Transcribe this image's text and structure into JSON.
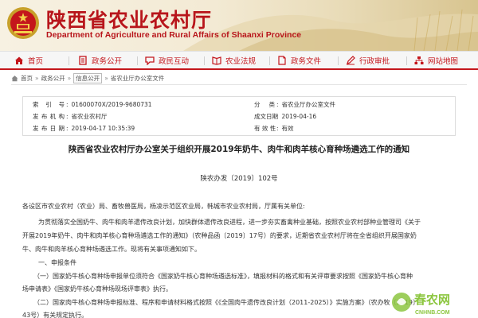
{
  "header": {
    "title": "陕西省农业农村厅",
    "subtitle": "Department of Agriculture and Rural Affairs of Shaanxi Province",
    "emblem_icon": "national-emblem",
    "brand_color": "#b8151b"
  },
  "nav": {
    "items": [
      {
        "label": "首页",
        "icon": "home-icon"
      },
      {
        "label": "政务公开",
        "icon": "document-icon"
      },
      {
        "label": "政民互动",
        "icon": "chat-icon"
      },
      {
        "label": "农业法规",
        "icon": "book-icon"
      },
      {
        "label": "政务文件",
        "icon": "file-icon"
      },
      {
        "label": "行政审批",
        "icon": "pen-icon"
      },
      {
        "label": "网站地图",
        "icon": "sitemap-icon"
      }
    ]
  },
  "breadcrumb": {
    "items": [
      "首页",
      "政务公开",
      "信息公开",
      "省农业厅办公室文件"
    ],
    "current_index": 2
  },
  "info": {
    "index_label": "索 引 号",
    "index_value": "01600070X/2019-9680731",
    "category_label": "分 类",
    "category_value": "省农业厅办公室文件",
    "publisher_label": "发布机构",
    "publisher_value": "省农业农村厅",
    "doc_date_label": "成文日期",
    "doc_date_value": "2019-04-16",
    "pub_date_label": "发布日期",
    "pub_date_value": "2019-04-17 10:35:39",
    "validity_label": "有 效 性",
    "validity_value": "有效"
  },
  "article": {
    "title": "陕西省农业农村厅办公室关于组织开展2019年奶牛、肉牛和肉羊核心育种场遴选工作的通知",
    "doc_no": "陕农办发〔2019〕102号",
    "recipients": "各设区市农业农村（农业）局、畜牧兽医局，杨凌示范区农业局，韩城市农业农村局，厅属有关单位:",
    "para1_line1": "为贯彻落实全国奶牛、肉牛和肉羊遗传改良计划，加快群体遗传改良进程，进一步夯实畜禽种业基础，按照农业农村部种业管理司《关于",
    "para1_line2": "开展2019年奶牛、肉牛和肉羊核心育种场遴选工作的通知》（农种品函〔2019〕17号）的要求，近期省农业农村厅将在全省组织开展国家奶",
    "para1_line3": "牛、肉牛和肉羊核心育种场遴选工作。现将有关事项通知如下。",
    "section1": "一、申报条件",
    "item1_line1": "（一）国家奶牛核心育种场申报单位须符合《国家奶牛核心育种场遴选标准》，填报材料的格式和有关评审要求按照《国家奶牛核心育种",
    "item1_line2": "场申请表》《国家奶牛核心育种场现场评审表》执行。",
    "item2_line1": "（二）国家肉牛核心育种场申报标准、程序和申请材料格式按照《《全国肉牛遗传改良计划（2011-2025）》实施方案》（农办牧〔2019〕",
    "item2_line2": "43号）有关规定执行。"
  },
  "watermark": {
    "text_cn": "春农网",
    "text_en": "CNHNB.COM",
    "color": "#8cc63f"
  }
}
